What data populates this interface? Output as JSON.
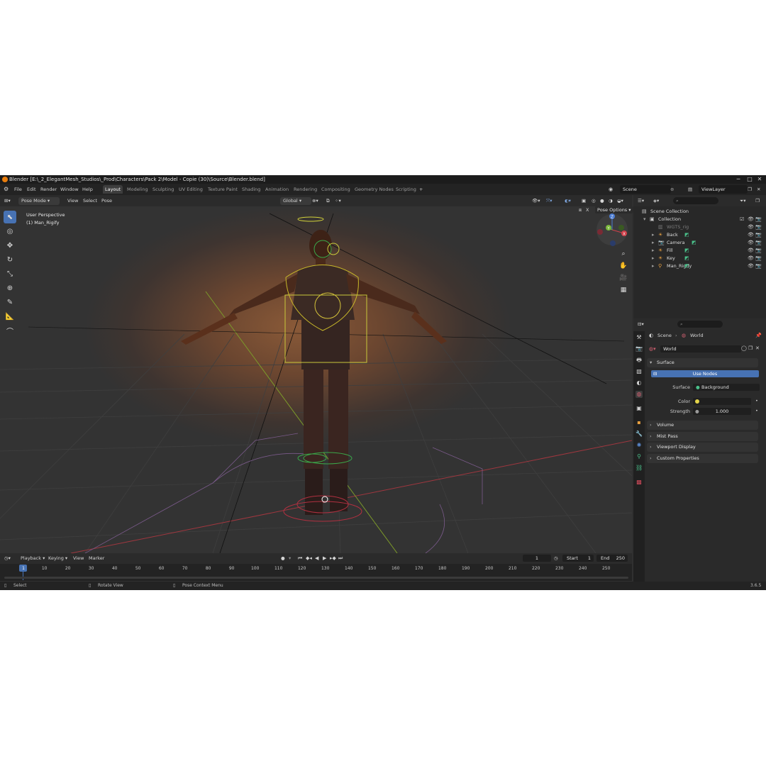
{
  "window": {
    "title": "Blender [E:\\_2_ElegantMesh_Studios\\_Prod\\Characters\\Pack 2\\Model - Copie (30)\\Source\\Blender.blend]",
    "minimize": "─",
    "maximize": "□",
    "close": "✕"
  },
  "menu": [
    "File",
    "Edit",
    "Render",
    "Window",
    "Help"
  ],
  "workspaces": [
    "Layout",
    "Modeling",
    "Sculpting",
    "UV Editing",
    "Texture Paint",
    "Shading",
    "Animation",
    "Rendering",
    "Compositing",
    "Geometry Nodes",
    "Scripting"
  ],
  "active_workspace": "Layout",
  "add_workspace": "+",
  "scene": {
    "label": "Scene",
    "viewlayer": "ViewLayer"
  },
  "viewport_header": {
    "mode": "Pose Mode",
    "menus": [
      "View",
      "Select",
      "Pose"
    ],
    "orientation": "Global",
    "pose_options": "Pose Options"
  },
  "viewport": {
    "perspective": "User Perspective",
    "object": "(1) Man_Rigify",
    "gizmo": {
      "z": "Z",
      "y": "Y",
      "x": "X"
    }
  },
  "timeline": {
    "menus": [
      "Playback",
      "Keying",
      "View",
      "Marker"
    ],
    "current_frame": "1",
    "start_label": "Start",
    "start": "1",
    "end_label": "End",
    "end": "250",
    "ticks": [
      "1",
      "10",
      "20",
      "30",
      "40",
      "50",
      "60",
      "70",
      "80",
      "90",
      "100",
      "110",
      "120",
      "130",
      "140",
      "150",
      "160",
      "170",
      "180",
      "190",
      "200",
      "210",
      "220",
      "230",
      "240",
      "250"
    ]
  },
  "statusbar": {
    "select": "Select",
    "rotate": "Rotate View",
    "context": "Pose Context Menu",
    "version": "3.6.5"
  },
  "outliner": {
    "root": "Scene Collection",
    "collection": "Collection",
    "items": [
      {
        "name": "WGTS_rig",
        "dim": true
      },
      {
        "name": "Back",
        "dim": false
      },
      {
        "name": "Camera",
        "dim": false
      },
      {
        "name": "Fill",
        "dim": false
      },
      {
        "name": "Key",
        "dim": false
      },
      {
        "name": "Man_Rigify",
        "dim": false
      }
    ]
  },
  "properties": {
    "breadcrumb": [
      "Scene",
      "World"
    ],
    "world_name": "World",
    "surface_panel": "Surface",
    "use_nodes": "Use Nodes",
    "surface_label": "Surface",
    "surface_value": "Background",
    "color_label": "Color",
    "strength_label": "Strength",
    "strength_value": "1.000",
    "panels": [
      "Volume",
      "Mist Pass",
      "Viewport Display",
      "Custom Properties"
    ]
  },
  "colors": {
    "accent": "#4772b3",
    "world_color_dot": "#e3d44a",
    "blender_orange": "#e87d0d"
  }
}
